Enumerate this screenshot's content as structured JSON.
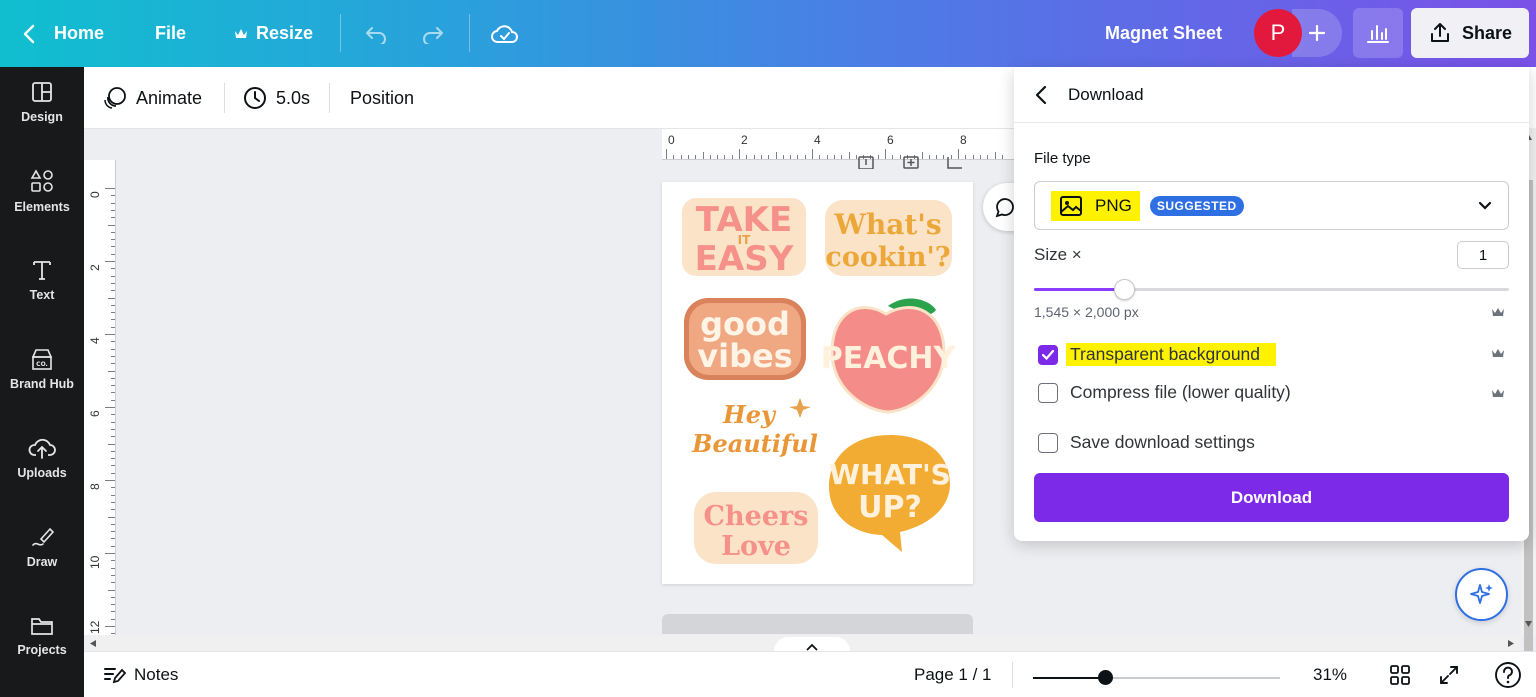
{
  "topbar": {
    "home": "Home",
    "file": "File",
    "resize": "Resize",
    "design_title": "Magnet Sheet",
    "avatar_initial": "P",
    "share": "Share"
  },
  "sidebar": {
    "items": [
      {
        "label": "Design",
        "icon": "layout-icon"
      },
      {
        "label": "Elements",
        "icon": "shapes-icon"
      },
      {
        "label": "Text",
        "icon": "text-icon"
      },
      {
        "label": "Brand Hub",
        "icon": "brand-icon"
      },
      {
        "label": "Uploads",
        "icon": "cloud-upload-icon"
      },
      {
        "label": "Draw",
        "icon": "pen-icon"
      },
      {
        "label": "Projects",
        "icon": "folder-icon"
      }
    ]
  },
  "toolbar": {
    "animate": "Animate",
    "duration": "5.0s",
    "position": "Position"
  },
  "rulers": {
    "top": [
      "0",
      "2",
      "4",
      "6",
      "8"
    ],
    "left": [
      "0",
      "2",
      "4",
      "6",
      "8",
      "10",
      "12"
    ]
  },
  "stickers": {
    "s1_line1": "TAKE",
    "s1_small": "IT",
    "s1_line2": "EASY",
    "s2_line1": "What's",
    "s2_line2": "cookin'?",
    "s3_line1": "good",
    "s3_line2": "vibes",
    "s4": "PEACHY",
    "s5_line1": "Hey",
    "s5_line2": "Beautiful",
    "s6_line1": "WHAT'S",
    "s6_line2": "UP?",
    "s7_line1": "Cheers",
    "s7_line2": "Love"
  },
  "download_panel": {
    "title": "Download",
    "file_type_label": "File type",
    "file_type_value": "PNG",
    "suggested_badge": "SUGGESTED",
    "size_label": "Size ×",
    "size_value": "1",
    "size_slider_fraction": 0.19,
    "dimensions": "1,545 × 2,000 px",
    "options": [
      {
        "label": "Transparent background",
        "checked": true
      },
      {
        "label": "Compress file (lower quality)",
        "checked": false
      },
      {
        "label": "Save download settings",
        "checked": false
      }
    ],
    "download_button": "Download"
  },
  "bottombar": {
    "notes": "Notes",
    "page_indicator": "Page 1 / 1",
    "zoom": "31%",
    "zoom_fraction": 0.29
  },
  "colors": {
    "accent_purple": "#7d2ae8",
    "highlight_yellow": "#fff200",
    "badge_blue": "#2f6fe4",
    "avatar_red": "#e2193d"
  }
}
